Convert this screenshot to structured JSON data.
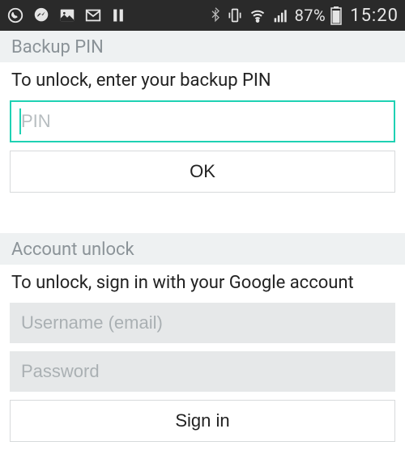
{
  "status_bar": {
    "icons_left": [
      "whatsapp",
      "messenger",
      "gallery",
      "gmail",
      "pause"
    ],
    "icons_right": [
      "bluetooth",
      "vibrate",
      "wifi",
      "signal"
    ],
    "battery_percent": "87%",
    "time": "15:20"
  },
  "backup_pin": {
    "header": "Backup PIN",
    "instruction": "To unlock, enter your backup PIN",
    "pin_placeholder": "PIN",
    "pin_value": "",
    "ok_label": "OK"
  },
  "account_unlock": {
    "header": "Account unlock",
    "instruction": "To unlock, sign in with your Google account",
    "username_placeholder": "Username (email)",
    "username_value": "",
    "password_placeholder": "Password",
    "password_value": "",
    "signin_label": "Sign in"
  }
}
